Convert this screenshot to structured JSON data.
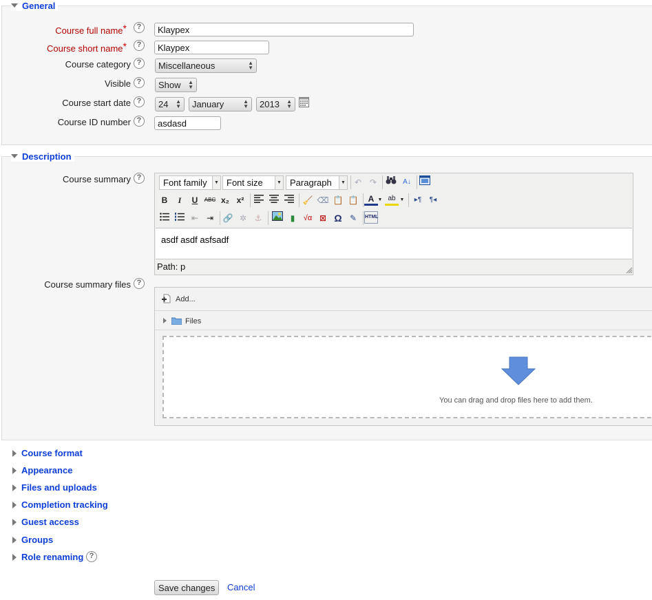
{
  "general": {
    "legend": "General",
    "fields": {
      "fullname": {
        "label": "Course full name",
        "value": "Klaypex",
        "required": true
      },
      "shortname": {
        "label": "Course short name",
        "value": "Klaypex",
        "required": true
      },
      "category": {
        "label": "Course category",
        "value": "Miscellaneous"
      },
      "visible": {
        "label": "Visible",
        "value": "Show"
      },
      "startdate": {
        "label": "Course start date",
        "day": "24",
        "month": "January",
        "year": "2013"
      },
      "idnumber": {
        "label": "Course ID number",
        "value": "asdasd"
      }
    },
    "required_marker": "*",
    "help_glyph": "?"
  },
  "description": {
    "legend": "Description",
    "summary_label": "Course summary",
    "editor": {
      "font_family": "Font family",
      "font_size": "Font size",
      "paragraph": "Paragraph",
      "content": "asdf asdf asfsadf",
      "path": "Path: p",
      "buttons_row2": [
        "B",
        "I",
        "U",
        "ABC",
        "x₂",
        "x²"
      ],
      "buttons_row3_omega": "Ω",
      "html_btn": "HTML"
    },
    "files_label": "Course summary files",
    "filepicker": {
      "add_label": "Add...",
      "folder_label": "Files",
      "drop_text": "You can drag and drop files here to add them."
    }
  },
  "collapsed_sections": [
    "Course format",
    "Appearance",
    "Files and uploads",
    "Completion tracking",
    "Guest access",
    "Groups",
    "Role renaming"
  ],
  "actions": {
    "save": "Save changes",
    "cancel": "Cancel"
  },
  "colors": {
    "link": "#0d3fd8",
    "required_label": "#b30000",
    "required_star": "#cc0000"
  }
}
